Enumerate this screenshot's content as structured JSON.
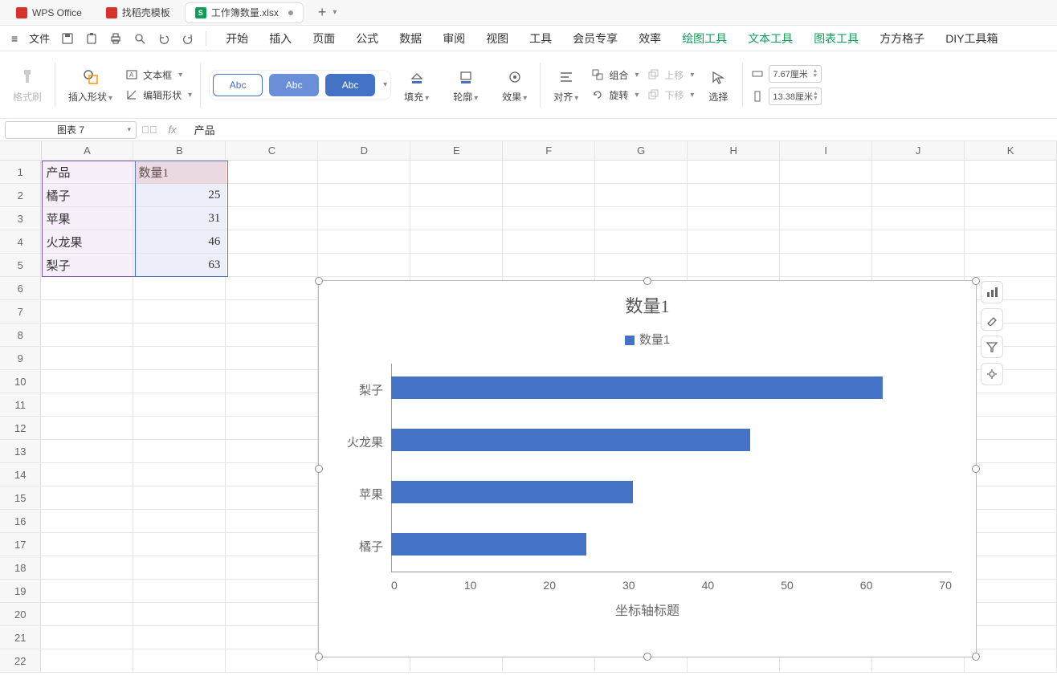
{
  "titlebar": {
    "app_name": "WPS Office",
    "template_tab": "找稻壳模板",
    "doc_tab": "工作簿数量.xlsx",
    "sheet_badge": "S"
  },
  "qat": {
    "file": "文件"
  },
  "menu": {
    "start": "开始",
    "insert": "插入",
    "page": "页面",
    "formula": "公式",
    "data": "数据",
    "review": "审阅",
    "view": "视图",
    "tool": "工具",
    "member": "会员专享",
    "eff": "效率",
    "draw": "绘图工具",
    "text": "文本工具",
    "chart": "图表工具",
    "square": "方方格子",
    "diy": "DIY工具箱"
  },
  "ribbon": {
    "fmt_brush": "格式刷",
    "insert_shape": "插入形状",
    "textbox": "文本框",
    "edit_shape": "编辑形状",
    "abc": "Abc",
    "fill": "填充",
    "outline": "轮廓",
    "effect": "效果",
    "align": "对齐",
    "group": "组合",
    "rotate": "旋转",
    "up": "上移",
    "down": "下移",
    "select": "选择",
    "w": "7.67厘米",
    "h": "13.38厘米"
  },
  "fx": {
    "name": "图表 7",
    "val": "产品"
  },
  "cols": [
    "A",
    "B",
    "C",
    "D",
    "E",
    "F",
    "G",
    "H",
    "I",
    "J",
    "K"
  ],
  "rows": [
    {
      "n": "1",
      "a": "产品",
      "b": "数量1"
    },
    {
      "n": "2",
      "a": "橘子",
      "b": "25"
    },
    {
      "n": "3",
      "a": "苹果",
      "b": "31"
    },
    {
      "n": "4",
      "a": "火龙果",
      "b": "46"
    },
    {
      "n": "5",
      "a": "梨子",
      "b": "63"
    },
    {
      "n": "6"
    },
    {
      "n": "7"
    },
    {
      "n": "8"
    },
    {
      "n": "9"
    },
    {
      "n": "10"
    },
    {
      "n": "11"
    },
    {
      "n": "12"
    },
    {
      "n": "13"
    },
    {
      "n": "14"
    },
    {
      "n": "15"
    },
    {
      "n": "16"
    },
    {
      "n": "17"
    },
    {
      "n": "18"
    },
    {
      "n": "19"
    },
    {
      "n": "20"
    },
    {
      "n": "21"
    },
    {
      "n": "22"
    }
  ],
  "chart_data": {
    "type": "bar",
    "title": "数量1",
    "legend": "数量1",
    "categories": [
      "梨子",
      "火龙果",
      "苹果",
      "橘子"
    ],
    "values": [
      63,
      46,
      31,
      25
    ],
    "xlabel": "坐标轴标题",
    "xticks": [
      "0",
      "10",
      "20",
      "30",
      "40",
      "50",
      "60",
      "70"
    ],
    "xmax": 70
  }
}
